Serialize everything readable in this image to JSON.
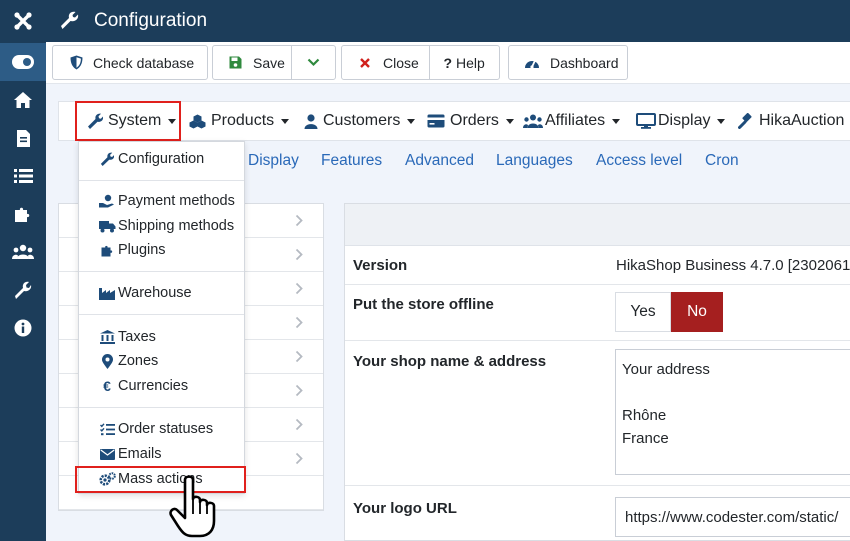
{
  "header": {
    "title": "Configuration"
  },
  "toolbar": {
    "check_database": "Check database",
    "save": "Save",
    "close": "Close",
    "help": "Help",
    "dashboard": "Dashboard"
  },
  "menubar": {
    "system": "System",
    "products": "Products",
    "customers": "Customers",
    "orders": "Orders",
    "affiliates": "Affiliates",
    "display": "Display",
    "hikaauction": "HikaAuction"
  },
  "subtabs": [
    "Display",
    "Features",
    "Advanced",
    "Languages",
    "Access level",
    "Cron"
  ],
  "dropdown": {
    "configuration": "Configuration",
    "payment_methods": "Payment methods",
    "shipping_methods": "Shipping methods",
    "plugins": "Plugins",
    "warehouse": "Warehouse",
    "taxes": "Taxes",
    "zones": "Zones",
    "currencies": "Currencies",
    "order_statuses": "Order statuses",
    "emails": "Emails",
    "mass_actions": "Mass actions"
  },
  "config": {
    "version_label": "Version",
    "version_value": "HikaShop Business 4.7.0 [2302061",
    "offline_label": "Put the store offline",
    "offline_yes": "Yes",
    "offline_no": "No",
    "address_label": "Your shop name & address",
    "address_lines": [
      "Your address",
      "",
      "Rhône",
      "France"
    ],
    "logo_label": "Your logo URL",
    "logo_value": "https://www.codester.com/static/"
  },
  "colors": {
    "sidebar": "#1c3d5a",
    "link": "#2a69b8",
    "no_active": "#a51f1f",
    "highlight": "#e0201c",
    "save_green": "#2f8a3e"
  }
}
